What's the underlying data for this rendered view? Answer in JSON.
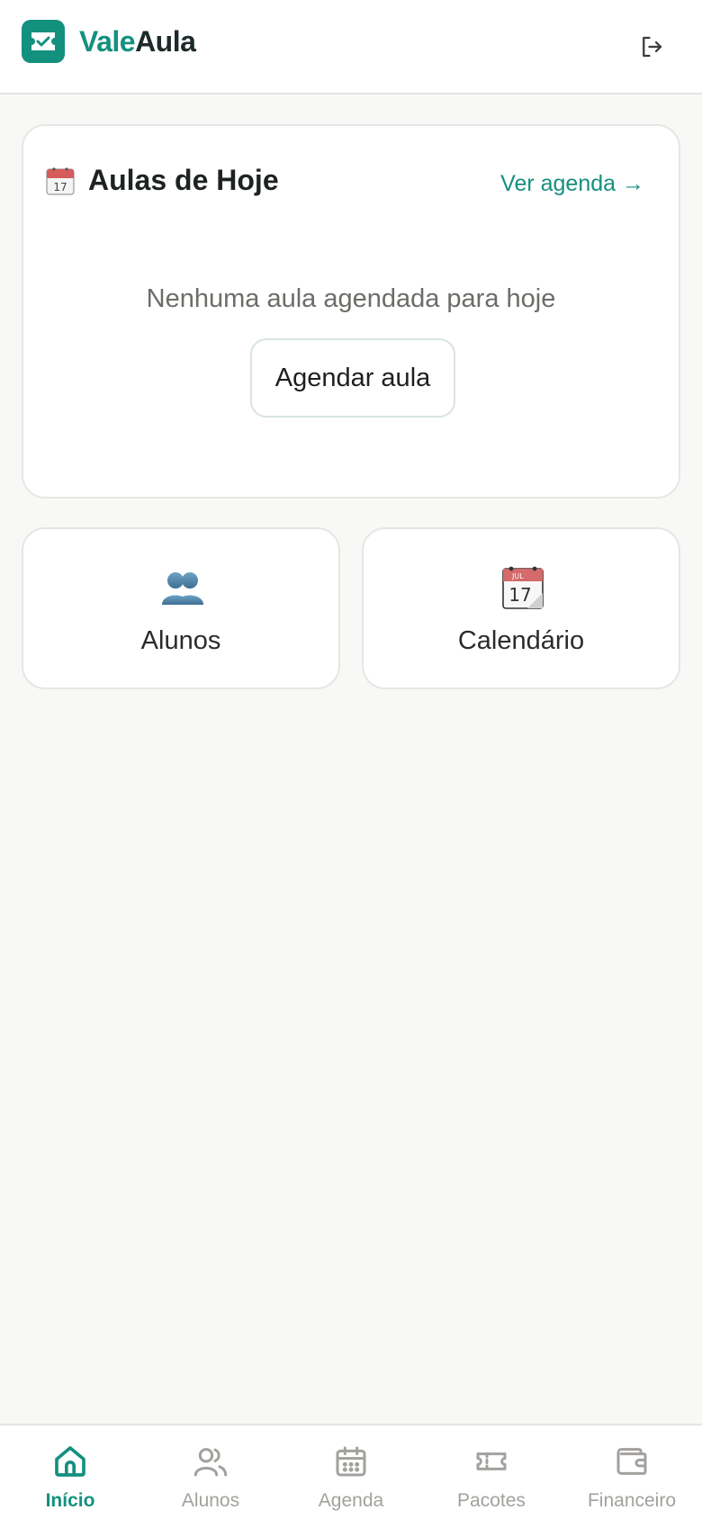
{
  "header": {
    "brand_part1": "Vale",
    "brand_part2": "Aula",
    "logo_icon": "ticket-check-icon",
    "logout_icon": "logout-icon"
  },
  "today_card": {
    "title": "Aulas de Hoje",
    "title_icon": "calendar-emoji-icon",
    "see_agenda_link": "Ver agenda →",
    "empty_message": "Nenhuma aula agendada para hoje",
    "schedule_button": "Agendar aula"
  },
  "tiles": [
    {
      "label": "Alunos",
      "icon": "students-emoji-icon"
    },
    {
      "label": "Calendário",
      "icon": "calendar-emoji-icon"
    }
  ],
  "bottom_nav": {
    "items": [
      {
        "label": "Início",
        "icon": "home-icon",
        "active": true
      },
      {
        "label": "Alunos",
        "icon": "users-icon",
        "active": false
      },
      {
        "label": "Agenda",
        "icon": "calendar-icon",
        "active": false
      },
      {
        "label": "Pacotes",
        "icon": "ticket-icon",
        "active": false
      },
      {
        "label": "Financeiro",
        "icon": "wallet-icon",
        "active": false
      }
    ]
  },
  "colors": {
    "brand": "#14907f",
    "background": "#f8f8f7",
    "inactive_nav": "#a3a19d"
  }
}
